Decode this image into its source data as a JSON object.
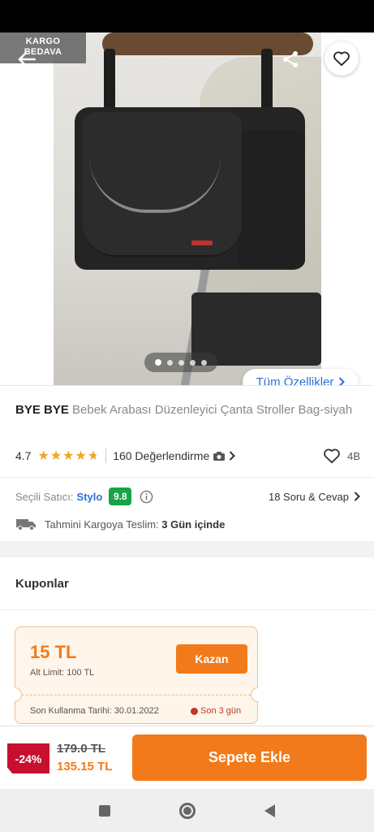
{
  "colors": {
    "accent": "#f27a1a",
    "link": "#2a6fdb",
    "discount": "#c8102e",
    "score": "#18a34a",
    "star": "#f5a623"
  },
  "header": {
    "back_icon": "arrow-left-icon",
    "share_icon": "share-icon",
    "favorite_icon": "heart-outline-icon",
    "cargo_line1": "KARGO",
    "cargo_line2": "BEDAVA"
  },
  "gallery": {
    "image_count": 5,
    "active_index": 0,
    "all_features_label": "Tüm Özellikler"
  },
  "product": {
    "brand": "BYE BYE",
    "name": "Bebek Arabası Düzenleyici Çanta Stroller Bag-siyah",
    "rating": "4.7",
    "rating_value": 4.7,
    "review_count": "160 Değerlendirme",
    "favorite_count": "4B"
  },
  "seller": {
    "label": "Seçili Satıcı:",
    "name": "Stylo",
    "score": "9.8",
    "qa_label": "18 Soru & Cevap"
  },
  "delivery": {
    "label": "Tahmini Kargoya Teslim:",
    "value": "3 Gün içinde"
  },
  "coupons": {
    "title": "Kuponlar",
    "amount": "15 TL",
    "limit": "Alt Limit: 100 TL",
    "claim_label": "Kazan",
    "expiry": "Son Kullanma Tarihi: 30.01.2022",
    "remaining": "Son 3 gün"
  },
  "purchase": {
    "discount": "-24%",
    "old_price": "179.0 TL",
    "new_price": "135.15 TL",
    "add_to_cart_label": "Sepete Ekle"
  }
}
